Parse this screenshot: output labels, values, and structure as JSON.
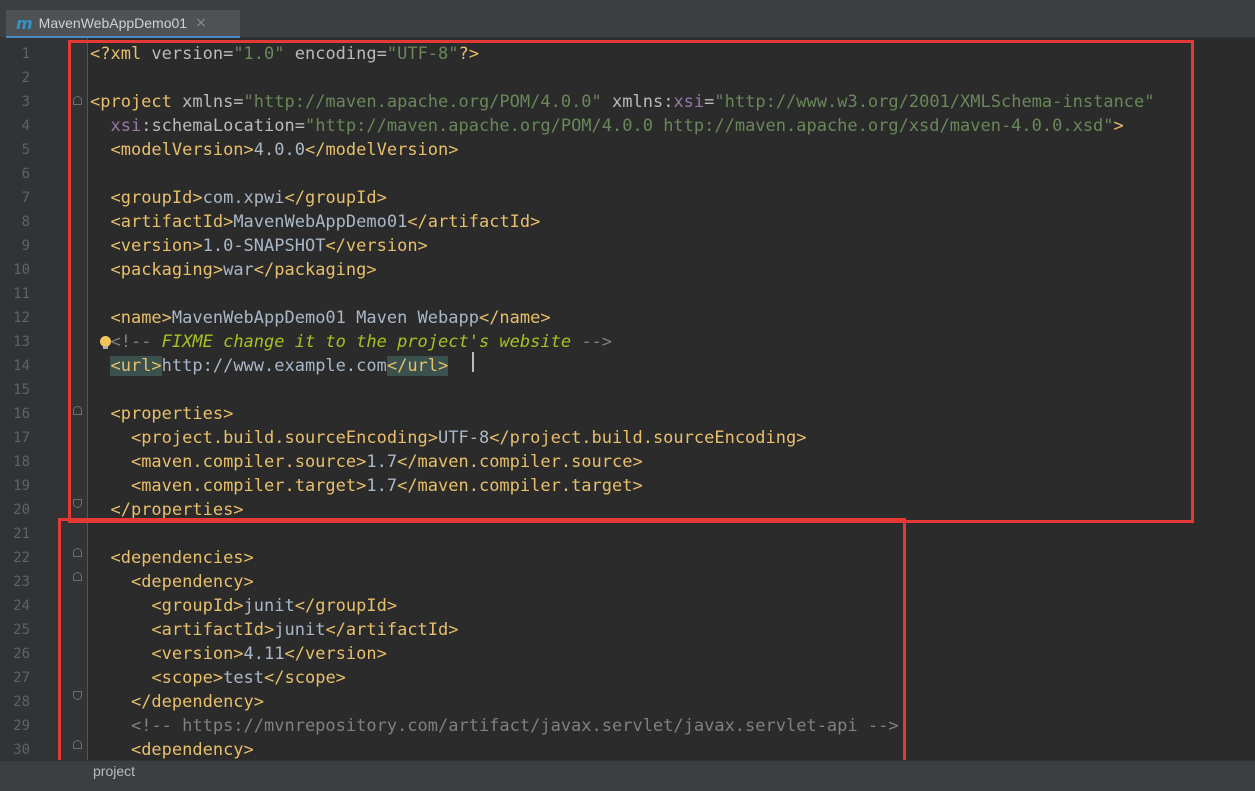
{
  "tab": {
    "icon": "m",
    "title": "MavenWebAppDemo01",
    "close": "×"
  },
  "breadcrumb": "project",
  "lines": [
    {
      "n": "1",
      "segs": [
        [
          "t",
          "<?xml "
        ],
        [
          "a",
          "version="
        ],
        [
          "v",
          "\"1.0\""
        ],
        [
          "a",
          " encoding="
        ],
        [
          "v",
          "\"UTF-8\""
        ],
        [
          "t",
          "?>"
        ]
      ]
    },
    {
      "n": "2",
      "segs": []
    },
    {
      "n": "3",
      "segs": [
        [
          "t",
          "<project "
        ],
        [
          "a",
          "xmlns="
        ],
        [
          "v",
          "\"http://maven.apache.org/POM/4.0.0\""
        ],
        [
          "a",
          " xmlns:"
        ],
        [
          "ns",
          "xsi"
        ],
        [
          "a",
          "="
        ],
        [
          "v",
          "\"http://www.w3.org/2001/XMLSchema-instance\""
        ]
      ]
    },
    {
      "n": "4",
      "segs": [
        [
          "p",
          "  "
        ],
        [
          "ns",
          "xsi"
        ],
        [
          "a",
          ":schemaLocation="
        ],
        [
          "v",
          "\"http://maven.apache.org/POM/4.0.0 http://maven.apache.org/xsd/maven-4.0.0.xsd\""
        ],
        [
          "t",
          ">"
        ]
      ]
    },
    {
      "n": "5",
      "segs": [
        [
          "p",
          "  "
        ],
        [
          "t",
          "<modelVersion>"
        ],
        [
          "p",
          "4.0.0"
        ],
        [
          "t",
          "</modelVersion>"
        ]
      ]
    },
    {
      "n": "6",
      "segs": []
    },
    {
      "n": "7",
      "segs": [
        [
          "p",
          "  "
        ],
        [
          "t",
          "<groupId>"
        ],
        [
          "p",
          "com.xpwi"
        ],
        [
          "t",
          "</groupId>"
        ]
      ]
    },
    {
      "n": "8",
      "segs": [
        [
          "p",
          "  "
        ],
        [
          "t",
          "<artifactId>"
        ],
        [
          "p",
          "MavenWebAppDemo01"
        ],
        [
          "t",
          "</artifactId>"
        ]
      ]
    },
    {
      "n": "9",
      "segs": [
        [
          "p",
          "  "
        ],
        [
          "t",
          "<version>"
        ],
        [
          "p",
          "1.0-SNAPSHOT"
        ],
        [
          "t",
          "</version>"
        ]
      ]
    },
    {
      "n": "10",
      "segs": [
        [
          "p",
          "  "
        ],
        [
          "t",
          "<packaging>"
        ],
        [
          "p",
          "war"
        ],
        [
          "t",
          "</packaging>"
        ]
      ]
    },
    {
      "n": "11",
      "segs": []
    },
    {
      "n": "12",
      "segs": [
        [
          "p",
          "  "
        ],
        [
          "t",
          "<name>"
        ],
        [
          "p",
          "MavenWebAppDemo01 Maven Webapp"
        ],
        [
          "t",
          "</name>"
        ]
      ]
    },
    {
      "n": "13",
      "segs": [
        [
          "p",
          "  "
        ],
        [
          "c",
          "<!-- "
        ],
        [
          "todo",
          "FIXME change it to the project's website"
        ],
        [
          "c",
          " -->"
        ]
      ]
    },
    {
      "n": "14",
      "segs": [
        [
          "p",
          "  "
        ],
        [
          "t hl",
          "<url>"
        ],
        [
          "p",
          "http://www.example.com"
        ],
        [
          "t hl",
          "</url>"
        ]
      ]
    },
    {
      "n": "15",
      "segs": []
    },
    {
      "n": "16",
      "segs": [
        [
          "p",
          "  "
        ],
        [
          "t",
          "<properties>"
        ]
      ]
    },
    {
      "n": "17",
      "segs": [
        [
          "p",
          "    "
        ],
        [
          "t",
          "<project.build.sourceEncoding>"
        ],
        [
          "p",
          "UTF-8"
        ],
        [
          "t",
          "</project.build.sourceEncoding>"
        ]
      ]
    },
    {
      "n": "18",
      "segs": [
        [
          "p",
          "    "
        ],
        [
          "t",
          "<maven.compiler.source>"
        ],
        [
          "p",
          "1.7"
        ],
        [
          "t",
          "</maven.compiler.source>"
        ]
      ]
    },
    {
      "n": "19",
      "segs": [
        [
          "p",
          "    "
        ],
        [
          "t",
          "<maven.compiler.target>"
        ],
        [
          "p",
          "1.7"
        ],
        [
          "t",
          "</maven.compiler.target>"
        ]
      ]
    },
    {
      "n": "20",
      "segs": [
        [
          "p",
          "  "
        ],
        [
          "t",
          "</properties>"
        ]
      ]
    },
    {
      "n": "21",
      "segs": []
    },
    {
      "n": "22",
      "segs": [
        [
          "p",
          "  "
        ],
        [
          "t",
          "<dependencies>"
        ]
      ]
    },
    {
      "n": "23",
      "segs": [
        [
          "p",
          "    "
        ],
        [
          "t",
          "<dependency>"
        ]
      ]
    },
    {
      "n": "24",
      "segs": [
        [
          "p",
          "      "
        ],
        [
          "t",
          "<groupId>"
        ],
        [
          "p",
          "junit"
        ],
        [
          "t",
          "</groupId>"
        ]
      ]
    },
    {
      "n": "25",
      "segs": [
        [
          "p",
          "      "
        ],
        [
          "t",
          "<artifactId>"
        ],
        [
          "p",
          "junit"
        ],
        [
          "t",
          "</artifactId>"
        ]
      ]
    },
    {
      "n": "26",
      "segs": [
        [
          "p",
          "      "
        ],
        [
          "t",
          "<version>"
        ],
        [
          "p",
          "4.11"
        ],
        [
          "t",
          "</version>"
        ]
      ]
    },
    {
      "n": "27",
      "segs": [
        [
          "p",
          "      "
        ],
        [
          "t",
          "<scope>"
        ],
        [
          "p",
          "test"
        ],
        [
          "t",
          "</scope>"
        ]
      ]
    },
    {
      "n": "28",
      "segs": [
        [
          "p",
          "    "
        ],
        [
          "t",
          "</dependency>"
        ]
      ]
    },
    {
      "n": "29",
      "segs": [
        [
          "p",
          "    "
        ],
        [
          "c",
          "<!-- https://mvnrepository.com/artifact/javax.servlet/javax.servlet-api -->"
        ]
      ]
    },
    {
      "n": "30",
      "segs": [
        [
          "p",
          "    "
        ],
        [
          "t",
          "<dependency>"
        ]
      ]
    }
  ]
}
